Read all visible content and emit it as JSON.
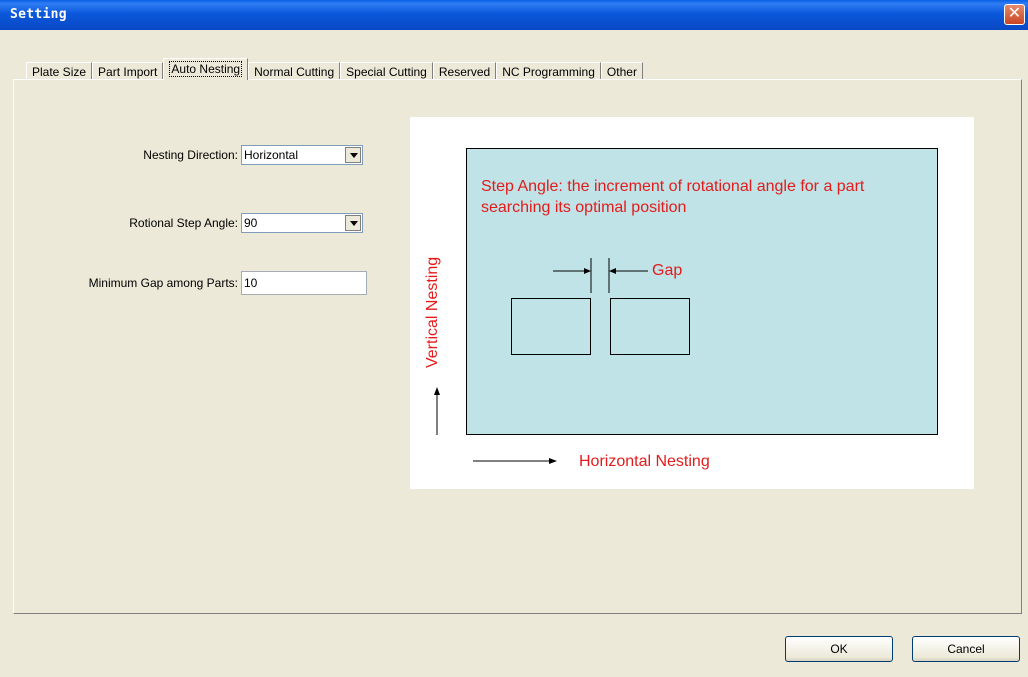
{
  "window": {
    "title": "Setting",
    "close_glyph": "✕"
  },
  "tabs": [
    {
      "label": "Plate Size",
      "active": false
    },
    {
      "label": "Part Import",
      "active": false
    },
    {
      "label": "Auto Nesting",
      "active": true
    },
    {
      "label": "Normal Cutting",
      "active": false
    },
    {
      "label": "Special Cutting",
      "active": false
    },
    {
      "label": "Reserved",
      "active": false
    },
    {
      "label": "NC Programming",
      "active": false
    },
    {
      "label": "Other",
      "active": false
    }
  ],
  "form": {
    "nesting_direction": {
      "label": "Nesting Direction:",
      "value": "Horizontal"
    },
    "rotational_step_angle": {
      "label": "Rotional Step Angle:",
      "value": "90"
    },
    "minimum_gap": {
      "label": "Minimum Gap among Parts:",
      "value": "10"
    }
  },
  "diagram": {
    "step_angle_text": "Step Angle: the increment of rotational angle for a part searching its optimal position",
    "gap_label": "Gap",
    "vertical_label": "Vertical Nesting",
    "horizontal_label": "Horizontal Nesting",
    "text_color": "#e41b1b",
    "plate_color": "#c0e3e7"
  },
  "buttons": {
    "ok": "OK",
    "cancel": "Cancel"
  }
}
